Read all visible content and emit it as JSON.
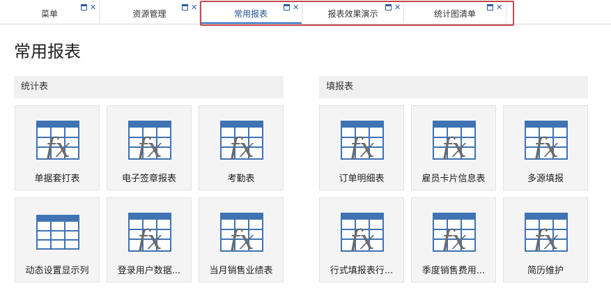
{
  "tabs": [
    {
      "label": "菜单",
      "active": false
    },
    {
      "label": "资源管理",
      "active": false
    },
    {
      "label": "常用报表",
      "active": true
    },
    {
      "label": "报表效果演示",
      "active": false
    },
    {
      "label": "统计图清单",
      "active": false
    }
  ],
  "page": {
    "title": "常用报表"
  },
  "sections": [
    {
      "title": "统计表",
      "items": [
        {
          "label": "单据套打表",
          "icon": "formula-table-icon"
        },
        {
          "label": "电子签章报表",
          "icon": "formula-table-icon"
        },
        {
          "label": "考勤表",
          "icon": "formula-table-icon"
        },
        {
          "label": "动态设置显示列",
          "icon": "table-grid-icon"
        },
        {
          "label": "登录用户数据...",
          "icon": "formula-table-icon"
        },
        {
          "label": "当月销售业绩表",
          "icon": "formula-table-icon"
        }
      ]
    },
    {
      "title": "填报表",
      "items": [
        {
          "label": "订单明细表",
          "icon": "formula-table-icon"
        },
        {
          "label": "雇员卡片信息表",
          "icon": "formula-table-icon"
        },
        {
          "label": "多源填报",
          "icon": "formula-table-icon"
        },
        {
          "label": "行式填报表行...",
          "icon": "formula-table-icon"
        },
        {
          "label": "季度销售费用...",
          "icon": "formula-table-icon"
        },
        {
          "label": "简历维护",
          "icon": "formula-table-icon"
        }
      ]
    }
  ],
  "colors": {
    "accent": "#2a6fc9",
    "icon_blue": "#3f73b3",
    "highlight": "#c24a4a"
  }
}
